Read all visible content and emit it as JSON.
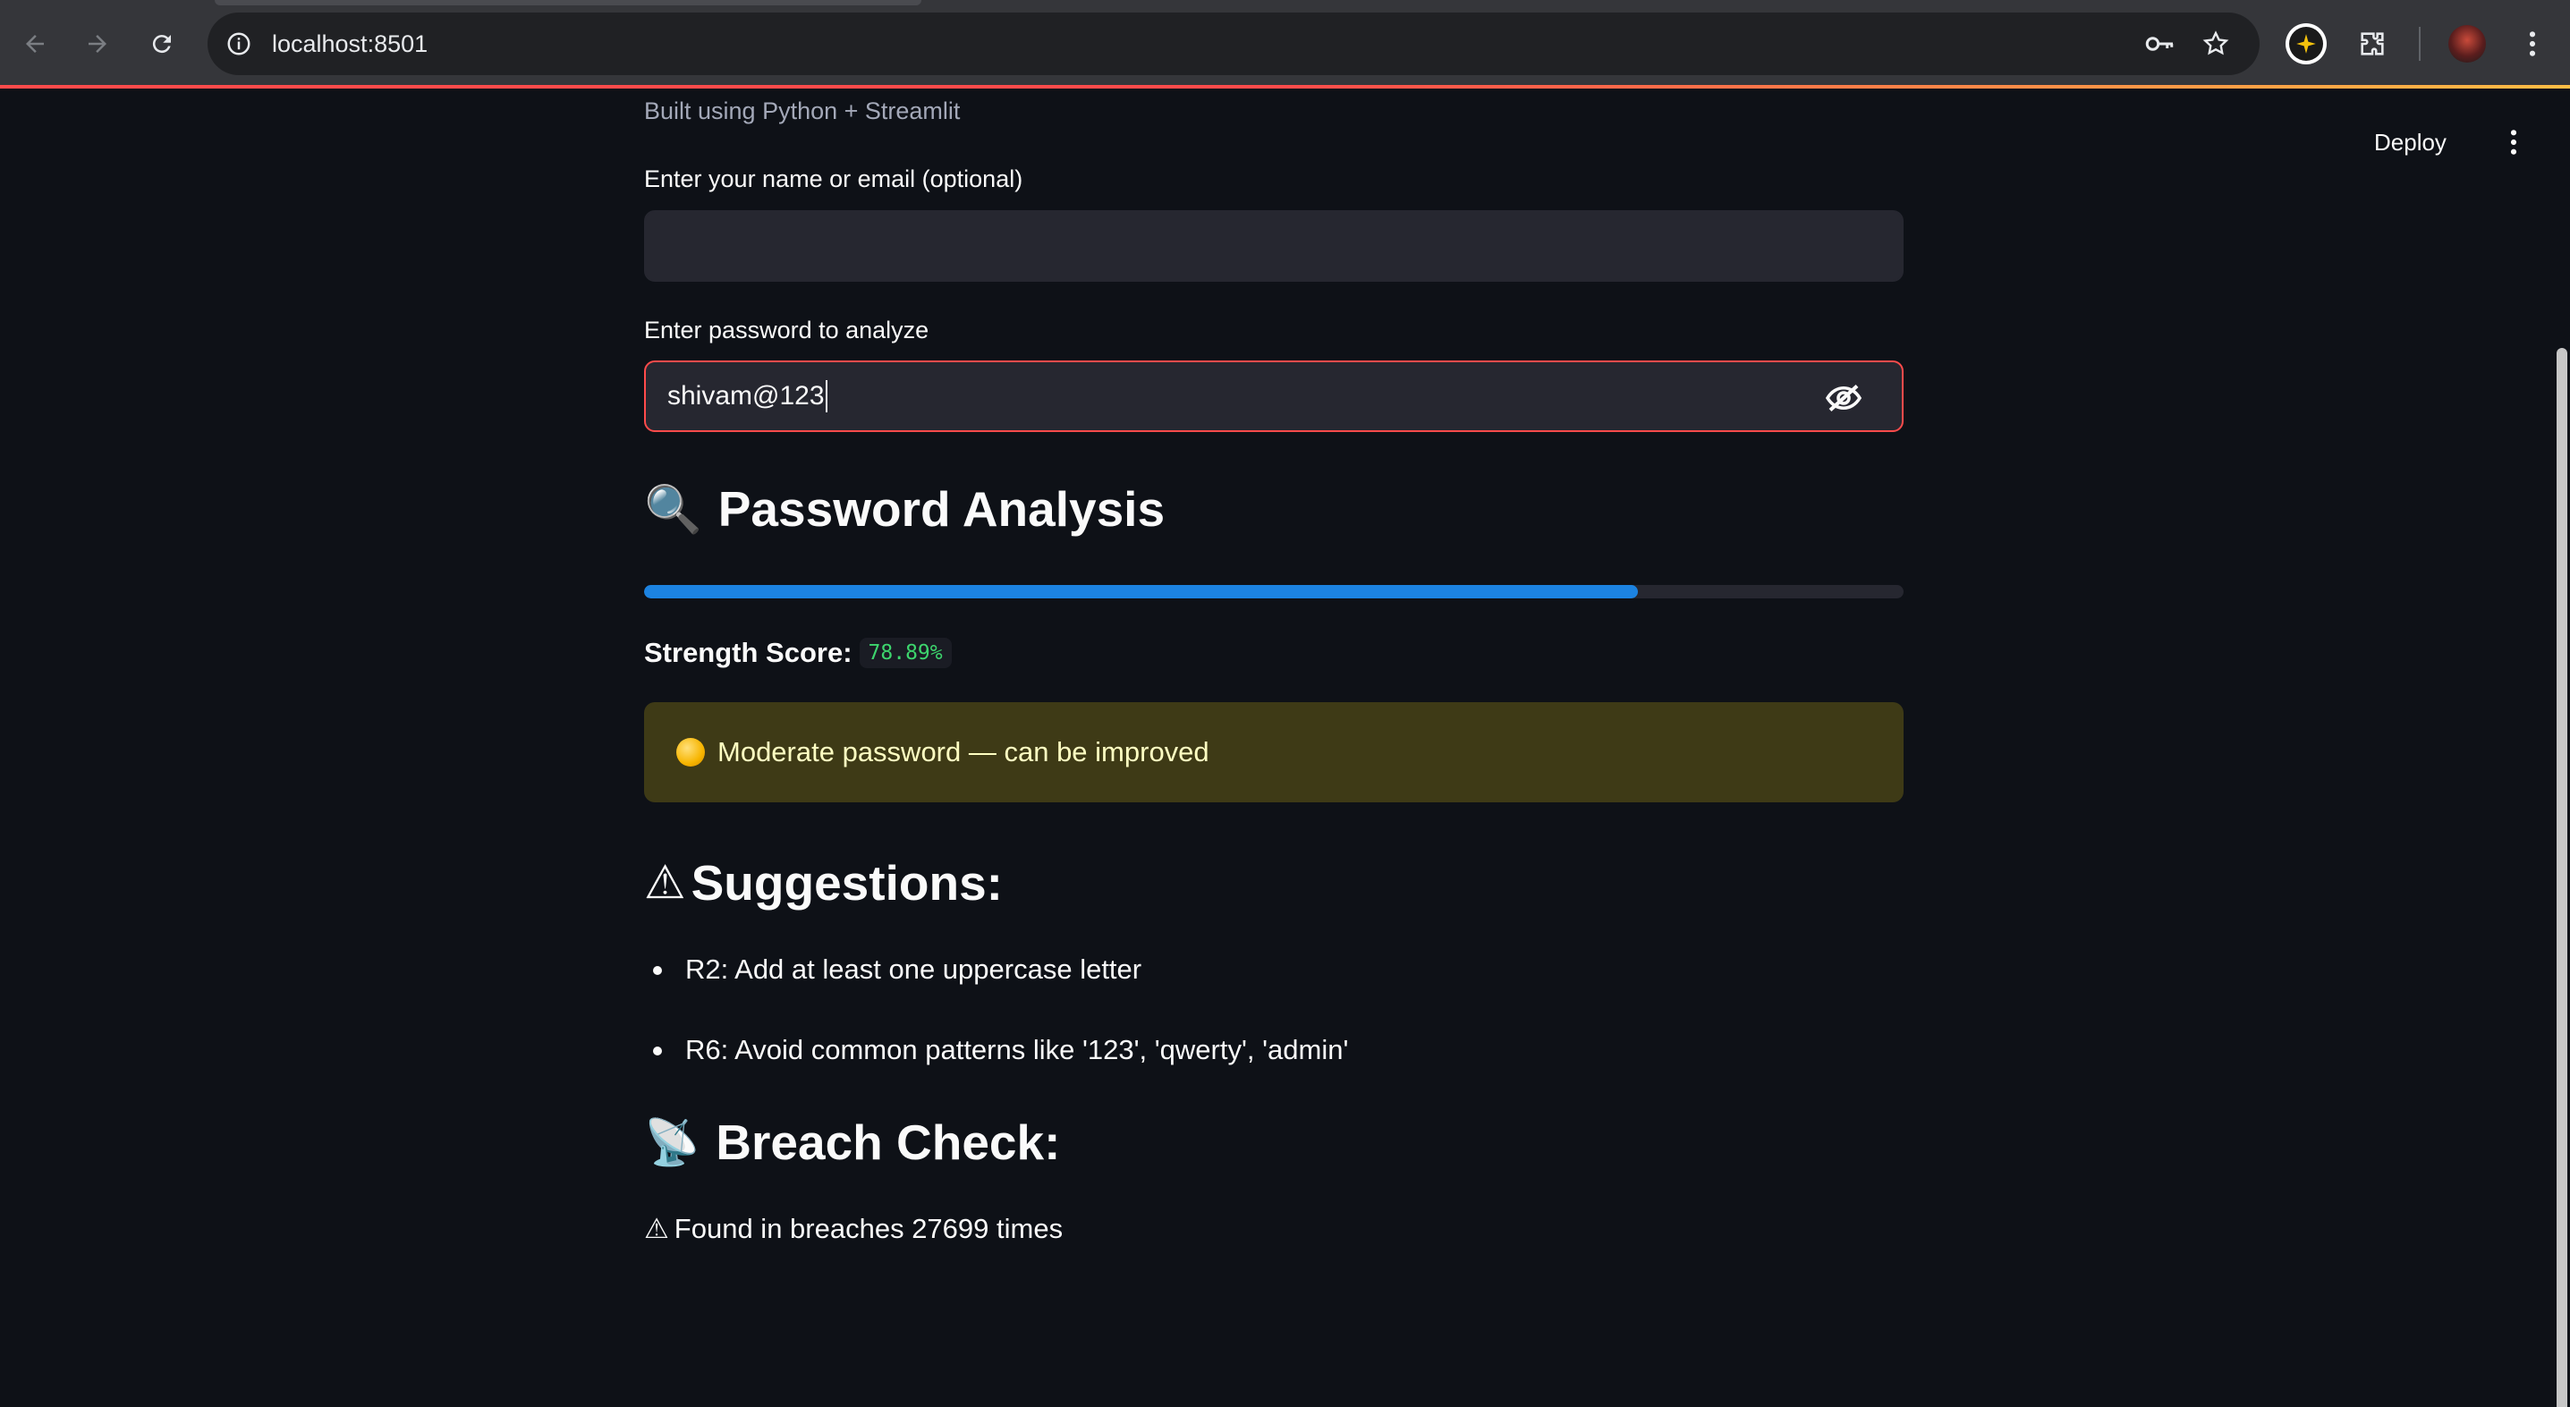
{
  "browser": {
    "url": "localhost:8501",
    "accent_gradient": [
      "#ff4b4b",
      "#ffbd45"
    ],
    "icons": {
      "back": "arrow-left-icon",
      "forward": "arrow-right-icon",
      "reload": "reload-icon",
      "site_info": "info-icon",
      "password_key": "key-icon",
      "bookmark": "star-icon",
      "extension_badge": "sparkle-icon",
      "extensions": "puzzle-icon",
      "menu": "kebab-icon"
    }
  },
  "app": {
    "deploy_label": "Deploy",
    "caption": "Built using Python + Streamlit",
    "name_input": {
      "label": "Enter your name or email (optional)",
      "value": ""
    },
    "password_input": {
      "label": "Enter password to analyze",
      "value": "shivam@123"
    },
    "analysis": {
      "icon": "🔍",
      "title": "Password Analysis",
      "progress": 0.7889,
      "score_label": "Strength Score:",
      "score_value": "78.89%",
      "status_text": "Moderate password — can be improved",
      "status_color": "#3e3a16"
    },
    "suggestions": {
      "icon": "⚠",
      "title": "Suggestions:",
      "items": [
        "R2: Add at least one uppercase letter",
        "R6: Avoid common patterns like '123', 'qwerty', 'admin'"
      ]
    },
    "breach": {
      "icon": "📡",
      "title": "Breach Check:",
      "result_icon": "⚠",
      "result_text": "Found in breaches 27699 times"
    }
  }
}
